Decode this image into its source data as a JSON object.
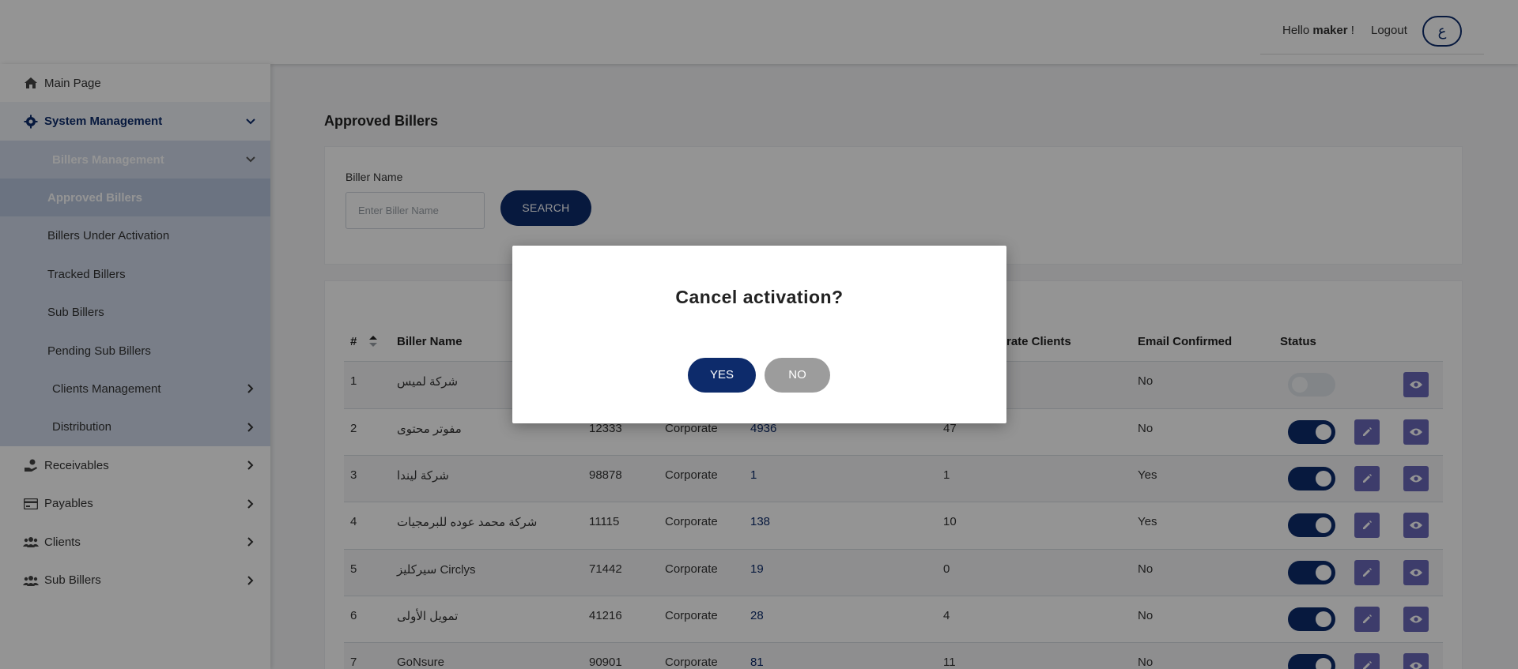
{
  "header": {
    "hello_prefix": "Hello",
    "username": "maker",
    "hello_suffix": "!",
    "logout": "Logout",
    "language_toggle": "ع"
  },
  "sidebar": {
    "main_page": "Main Page",
    "system_management": "System Management",
    "billers_management": "Billers Management",
    "billers_items": [
      "Approved Billers",
      "Billers Under Activation",
      "Tracked Billers",
      "Sub Billers",
      "Pending Sub Billers"
    ],
    "clients_management": "Clients Management",
    "distribution": "Distribution",
    "receivables": "Receivables",
    "payables": "Payables",
    "clients": "Clients",
    "sub_billers": "Sub Billers"
  },
  "page": {
    "title": "Approved Billers"
  },
  "search": {
    "label": "Biller Name",
    "placeholder": "Enter Biller Name",
    "button": "SEARCH"
  },
  "table": {
    "headers": {
      "num": "#",
      "biller_name": "Biller Name",
      "corporate_clients": "rate Clients",
      "email_confirmed": "Email Confirmed",
      "status": "Status"
    },
    "rows": [
      {
        "num": "1",
        "name": "شركة لميس",
        "code": "",
        "type": "",
        "count1": "",
        "count2": "",
        "email": "No",
        "status": "off"
      },
      {
        "num": "2",
        "name": "مفوتر محتوى",
        "code": "12333",
        "type": "Corporate",
        "count1": "4936",
        "count2": "47",
        "email": "No",
        "status": "on"
      },
      {
        "num": "3",
        "name": "شركة ليندا",
        "code": "98878",
        "type": "Corporate",
        "count1": "1",
        "count2": "1",
        "email": "Yes",
        "status": "on"
      },
      {
        "num": "4",
        "name": "شركة محمد عوده للبرمجيات",
        "code": "11115",
        "type": "Corporate",
        "count1": "138",
        "count2": "10",
        "email": "Yes",
        "status": "on"
      },
      {
        "num": "5",
        "name": "سيركليز Circlys",
        "code": "71442",
        "type": "Corporate",
        "count1": "19",
        "count2": "0",
        "email": "No",
        "status": "on"
      },
      {
        "num": "6",
        "name": "تمويل الأولى",
        "code": "41216",
        "type": "Corporate",
        "count1": "28",
        "count2": "4",
        "email": "No",
        "status": "on"
      },
      {
        "num": "7",
        "name": "GoNsure",
        "code": "90901",
        "type": "Corporate",
        "count1": "81",
        "count2": "11",
        "email": "No",
        "status": "on"
      }
    ]
  },
  "modal": {
    "title": "Cancel activation?",
    "yes": "YES",
    "no": "NO"
  },
  "colors": {
    "primary": "#0d2b6b",
    "action_button": "#6a68b8",
    "no_button": "#9c9c9c",
    "sidebar_submenu": "#d0daeb"
  },
  "icons": {
    "main_page": "home-icon",
    "system_management": "gear-icon",
    "receivables": "hand-coin-icon",
    "payables": "credit-card-icon",
    "clients": "users-icon",
    "sub_billers": "users-icon",
    "edit": "pencil-icon",
    "view": "eye-icon",
    "sort": "sort-icon"
  }
}
